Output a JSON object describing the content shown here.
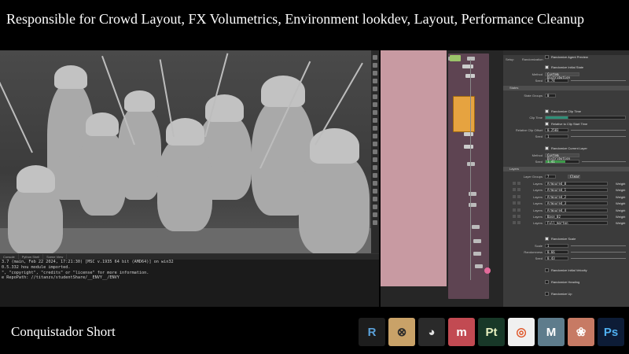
{
  "header": {
    "title": "Responsible for Crowd Layout, FX Volumetrics, Environment lookdev, Layout, Performance Cleanup"
  },
  "footer": {
    "caption": "Conquistador Short"
  },
  "console": {
    "tabs": [
      "Console",
      "Python Shell",
      "Scene View"
    ],
    "lines": [
      "3.7 (main, Feb 22 2024, 17:21:30) [MSC v.1935 64 bit (AMD64)] on win32",
      "0.5.332 hou module imported.",
      "\", \"copyright\", \"credits\" or \"license\" for more information.",
      "e RepoPath: //titanzs/studentShare/__ENVY__/ENVY"
    ]
  },
  "params": {
    "tabs": [
      "Setup",
      "Randomization"
    ],
    "agent_preview": "Randomize Agent Preview",
    "initial_state": {
      "label": "Randomize Initial State",
      "method_label": "Method",
      "method_value": "Custom Distribution",
      "seed_label": "Seed",
      "seed_value": "0.74"
    },
    "states": {
      "section": "States",
      "num_label": "State Groups",
      "num_value": "0"
    },
    "clip_time": {
      "label": "Randomize Clip Time",
      "clip_label": "Clip Time",
      "relative_label": "Relative to Clip Start Time",
      "offset_label": "Relative Clip Offset",
      "offset_value": "0.2583",
      "seed_label": "Seed",
      "seed_value": "1"
    },
    "current_layer": {
      "label": "Randomize Current Layer",
      "method_label": "Method",
      "method_value": "Custom Distribution",
      "seed_label": "Seed",
      "seed_value": "1.41"
    },
    "layers": {
      "section": "Layers",
      "groups_label": "Layer Groups",
      "groups_value": "7",
      "clear": "Clear",
      "row_label": "Layers",
      "weight_label": "Weight",
      "items": [
        "Armoured_0",
        "Armoured_1",
        "Armoured_2",
        "Armoured_3",
        "Armoured_4",
        "Base_02",
        "Full_morton"
      ]
    },
    "scale": {
      "label": "Randomize Scale",
      "scale_label": "Scale",
      "scale_value": "1",
      "rand_label": "Randomness",
      "rand_value": "0.66",
      "seed_label": "Seed",
      "seed_value": "0.43"
    },
    "velocity": "Randomize Initial Velocity",
    "heading": "Randomize Heading",
    "up": "Randomize Up"
  },
  "logos": [
    {
      "name": "renderman-logo",
      "text": "R",
      "bg": "#1d1d1d",
      "fg": "#5aa0d8"
    },
    {
      "name": "houdini-engine-logo",
      "text": "⊗",
      "bg": "#c9a268",
      "fg": "#2a2a2a"
    },
    {
      "name": "davinci-resolve-logo",
      "text": "◕",
      "bg": "#2a2a2a",
      "fg": "#e0e0e0"
    },
    {
      "name": "mari-logo",
      "text": "m",
      "bg": "#c24a52",
      "fg": "#ffffff"
    },
    {
      "name": "substance-painter-logo",
      "text": "Pt",
      "bg": "#183828",
      "fg": "#e8f0c0"
    },
    {
      "name": "houdini-logo",
      "text": "◎",
      "bg": "#f0f0f0",
      "fg": "#e0572a"
    },
    {
      "name": "maya-logo",
      "text": "M",
      "bg": "#5e7c8c",
      "fg": "#ffffff"
    },
    {
      "name": "lotus-logo",
      "text": "❀",
      "bg": "#c77a64",
      "fg": "#ffffff"
    },
    {
      "name": "photoshop-logo",
      "text": "Ps",
      "bg": "#0d1c36",
      "fg": "#4fb0f0"
    }
  ]
}
